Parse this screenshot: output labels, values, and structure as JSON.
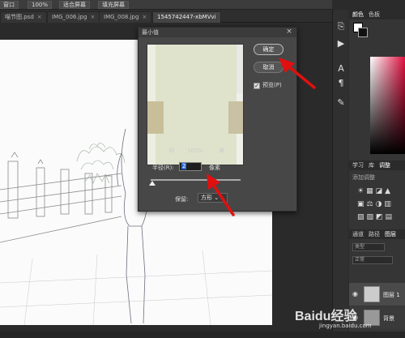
{
  "options_bar": {
    "item1": "窗口",
    "zoom": "100%",
    "fit_screen": "适合屏幕",
    "fill_screen": "填充屏幕"
  },
  "tabs": [
    {
      "label": "喵节图.psd"
    },
    {
      "label": "IMG_006.jpg"
    },
    {
      "label": "IMG_008.jpg"
    },
    {
      "label": "1545742447-xbMVvi"
    }
  ],
  "dialog": {
    "title": "最小值",
    "ok": "确定",
    "cancel": "取消",
    "preview_label": "预览(P)",
    "preview_checked": true,
    "zoom": "100%",
    "radius_label": "半径(R):",
    "radius_value": "2",
    "radius_unit": "像素",
    "slider_position": 0.02,
    "keep_label": "保留:",
    "keep_value": "方形"
  },
  "right_panel": {
    "tab_color": "颜色",
    "tab_swatch": "色板",
    "tab_learn": "学习",
    "tab_library": "库",
    "tab_adjust": "调整",
    "add_adjustment": "添加调整",
    "tab_channel": "通道",
    "tab_path": "路径",
    "tab_layer": "图层",
    "kind_filter": "类型",
    "blend_mode": "正常",
    "layer_name": "图层 1",
    "background_layer": "背景"
  },
  "watermark": {
    "brand": "Baidu经验",
    "url": "jingyan.baidu.com"
  },
  "colors": {
    "arrow": "#e01010",
    "ui_dark": "#353535",
    "dialog": "#474747"
  }
}
